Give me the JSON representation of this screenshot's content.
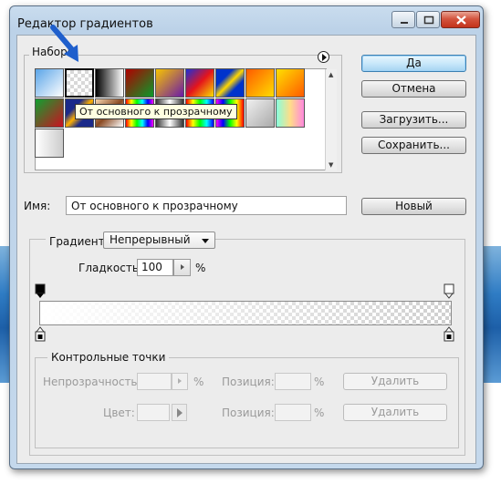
{
  "window": {
    "title": "Редактор градиентов"
  },
  "presets": {
    "legend": "Наборы",
    "tooltip": "От основного к прозрачному",
    "swatches": [
      "linear-gradient(135deg,#5aa5e8,#ffffff)",
      "repeating-conic-gradient(#d8d8d8 0 25%, #ffffff 0 50%) 0 0/8px 8px",
      "linear-gradient(90deg,#000000,#ffffff)",
      "linear-gradient(135deg,#b00000,#0a9a2a)",
      "linear-gradient(135deg,#f7c400,#6a1aa8)",
      "linear-gradient(135deg,#1c2fd8,#e5141b,#f7e000)",
      "linear-gradient(135deg,#0033cc 30%,#ffd800 50%,#0033cc 70%)",
      "linear-gradient(135deg,#ff5a00,#ffdd00)",
      "linear-gradient(135deg,#ffe000,#ff5a00)",
      "linear-gradient(135deg,#10a030,#cc1020)",
      "linear-gradient(135deg,#1b2a8a 30%,#ffb000 50%,#1b2a8a 70%)",
      "linear-gradient(135deg,#f5d6b0,#8a4a22,#ffffff)",
      "linear-gradient(90deg,#ff0000,#ffff00,#00ff00,#00ffff,#0000ff,#ff00ff)",
      "linear-gradient(90deg,#333,#fff,#333)",
      "linear-gradient(90deg,#ff0000,#ffff00,#00ff00,#00ffff,#0000ff)",
      "linear-gradient(90deg,#ff00ff,#0000ff,#00ff00,#ffff00,#ff0000)",
      "linear-gradient(135deg,#f0f0f0,#aaa)",
      "linear-gradient(90deg,#8fd,#fd8,#f8d)",
      "linear-gradient(90deg,#fff,#ccc)"
    ]
  },
  "buttons": {
    "ok": "Да",
    "cancel": "Отмена",
    "load": "Загрузить...",
    "save": "Сохранить...",
    "new": "Новый"
  },
  "name": {
    "label": "Имя:",
    "value": "От основного к прозрачному"
  },
  "gradient": {
    "type_label": "Градиент:",
    "type_value": "Непрерывный",
    "smoothness_label": "Гладкость:",
    "smoothness_value": "100",
    "smoothness_unit": "%"
  },
  "colors": {
    "title_bar": "#bcd2e8",
    "default_button": "#a6d3f1",
    "close_button": "#c2321b",
    "annotation_arrow": "#1f5fcc"
  },
  "stops": {
    "legend": "Контрольные точки",
    "opacity_label": "Непрозрачность:",
    "opacity_unit": "%",
    "position_label": "Позиция:",
    "position_unit": "%",
    "delete_label": "Удалить",
    "color_label": "Цвет:",
    "position2_label": "Позиция:",
    "position2_unit": "%",
    "delete2_label": "Удалить"
  }
}
